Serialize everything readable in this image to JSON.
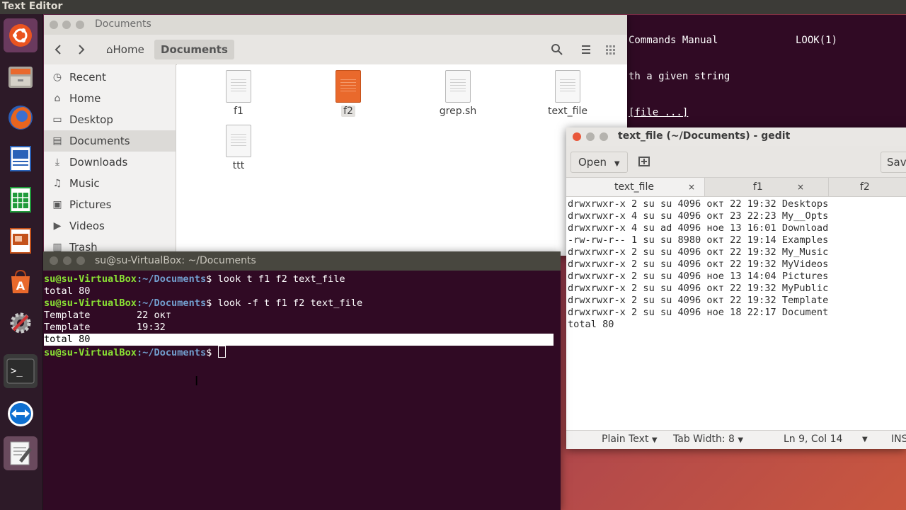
{
  "top_panel": {
    "title": "Text Editor"
  },
  "launcher": {
    "items": [
      {
        "name": "ubuntu-dash-icon"
      },
      {
        "name": "files-icon"
      },
      {
        "name": "firefox-icon"
      },
      {
        "name": "writer-icon"
      },
      {
        "name": "calc-icon"
      },
      {
        "name": "impress-icon"
      },
      {
        "name": "software-center-icon"
      },
      {
        "name": "settings-icon"
      },
      {
        "name": "terminal-icon"
      },
      {
        "name": "teamviewer-icon"
      },
      {
        "name": "text-editor-icon"
      }
    ]
  },
  "nautilus": {
    "title": "Documents",
    "path": {
      "home": "Home",
      "current": "Documents"
    },
    "sidebar": [
      {
        "label": "Recent",
        "icon": "clock-icon",
        "glyph": "◷"
      },
      {
        "label": "Home",
        "icon": "home-icon",
        "glyph": "⌂"
      },
      {
        "label": "Desktop",
        "icon": "desktop-icon",
        "glyph": "▭"
      },
      {
        "label": "Documents",
        "icon": "documents-icon",
        "glyph": "▤"
      },
      {
        "label": "Downloads",
        "icon": "downloads-icon",
        "glyph": "⤓"
      },
      {
        "label": "Music",
        "icon": "music-icon",
        "glyph": "♫"
      },
      {
        "label": "Pictures",
        "icon": "pictures-icon",
        "glyph": "▣"
      },
      {
        "label": "Videos",
        "icon": "videos-icon",
        "glyph": "▶"
      },
      {
        "label": "Trash",
        "icon": "trash-icon",
        "glyph": "🗑"
      }
    ],
    "files": [
      {
        "label": "f1",
        "color": "plain"
      },
      {
        "label": "f2",
        "color": "orange"
      },
      {
        "label": "grep.sh",
        "color": "plain"
      },
      {
        "label": "text_file",
        "color": "plain"
      },
      {
        "label": "ttt",
        "color": "plain"
      }
    ]
  },
  "man_page": {
    "lines": [
      {
        "text": "Commands Manual             LOOK(1)"
      },
      {
        "text": "th a given string"
      },
      {
        "text": "[file ...]"
      }
    ]
  },
  "terminal": {
    "title": "su@su-VirtualBox: ~/Documents",
    "prompt_user": "su@su-VirtualBox",
    "prompt_path": ":~/Documents",
    "lines": [
      {
        "type": "cmd",
        "text": "$ look t f1 f2 text_file"
      },
      {
        "type": "out",
        "text": "total 80"
      },
      {
        "type": "cmd",
        "text": "$ look -f t f1 f2 text_file"
      },
      {
        "type": "out",
        "text": "Template        22 окт"
      },
      {
        "type": "out",
        "text": "Template        19:32"
      },
      {
        "type": "hl",
        "text": "total 80"
      },
      {
        "type": "cmd",
        "text": "$ "
      }
    ]
  },
  "gedit": {
    "title": "text_file (~/Documents) - gedit",
    "open_label": "Open",
    "save_label": "Save",
    "tabs": [
      "text_file",
      "f1",
      "f2"
    ],
    "close_glyph": "×",
    "lines": [
      "drwxrwxr-x 2 su su 4096 окт 22 19:32 Desktops",
      "drwxrwxr-x 4 su su 4096 окт 23 22:23 My__Opts",
      "drwxrwxr-x 4 su ad 4096 ное 13 16:01 Download",
      "-rw-rw-r-- 1 su su 8980 окт 22 19:14 Examples",
      "drwxrwxr-x 2 su su 4096 окт 22 19:32 My_Music",
      "drwxrwxr-x 2 su su 4096 окт 22 19:32 MyVideos",
      "drwxrwxr-x 2 su su 4096 ное 13 14:04 Pictures",
      "drwxrwxr-x 2 su su 4096 окт 22 19:32 MyPublic",
      "drwxrwxr-x 2 su su 4096 окт 22 19:32 Template",
      "drwxrwxr-x 2 su su 4096 ное 18 22:17 Document",
      "total 80"
    ],
    "status": {
      "syntax": "Plain Text",
      "tab_width": "Tab Width: 8",
      "position": "Ln 9, Col 14",
      "mode": "INS"
    }
  }
}
